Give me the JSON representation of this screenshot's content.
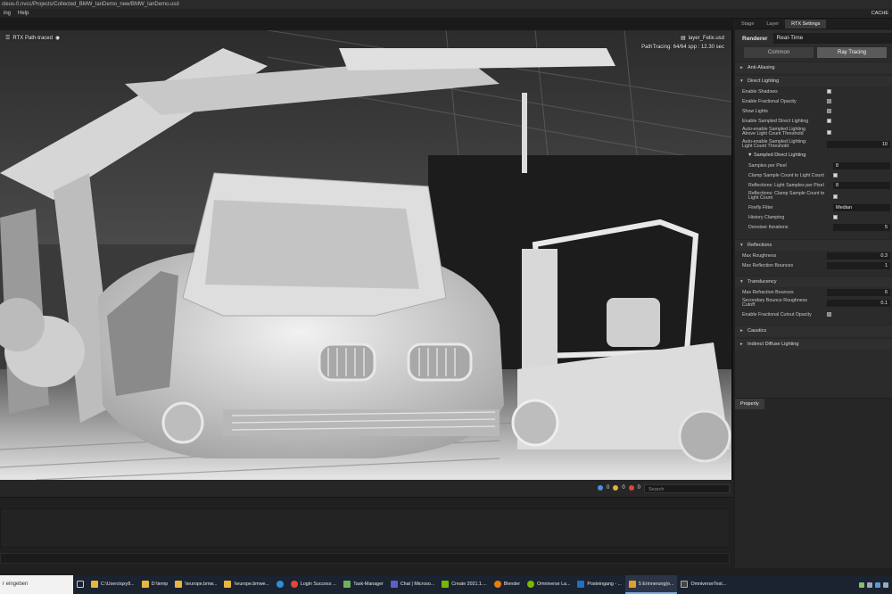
{
  "window": {
    "title_path": "cleus-0.nvcc/Projects/Collected_BMW_IanDemo_new/BMW_IanDemo.usd"
  },
  "menu": {
    "items": [
      "ing",
      "Help"
    ],
    "cache_label": "CACHE"
  },
  "viewport": {
    "render_mode": "RTX Path-traced",
    "layer_name": "layer_Felix.usd",
    "stats": "PathTracing: 64/64 spp : 12.30 sec"
  },
  "right_panel": {
    "tabs": [
      "Stage",
      "Layer",
      "RTX Settings"
    ],
    "active_tab": "RTX Settings",
    "renderer_label": "Renderer",
    "renderer_value": "Real-Time",
    "mode_buttons": [
      "Common",
      "Ray Tracing"
    ],
    "active_mode": "Ray Tracing",
    "sections": {
      "anti_aliasing": "Anti-Aliasing",
      "direct_lighting": "Direct Lighting",
      "reflections": "Reflections",
      "translucency": "Translucency",
      "caustics": "Caustics",
      "indirect_diffuse": "Indirect Diffuse Lighting"
    },
    "direct_lighting": {
      "enable_shadows": "Enable Shadows",
      "enable_fractional_opacity": "Enable Fractional Opacity",
      "show_lights": "Show Lights",
      "enable_sampled_direct": "Enable Sampled Direct Lighting",
      "auto_enable_above_line1": "Auto-enable Sampled Lighting",
      "auto_enable_above_line2": "Above Light Count Threshold",
      "auto_threshold_line1": "Auto-enable Sampled Lighting:",
      "auto_threshold_line2": "Light Count Threshold",
      "auto_threshold_value": "10",
      "sampled_subheader": "Sampled Direct Lighting",
      "samples_per_pixel": "Samples per Pixel",
      "samples_per_pixel_value": "8",
      "clamp_sample_count": "Clamp Sample Count to Light Count",
      "reflections_light_samples": "Reflections: Light Samples per Pixel",
      "reflections_light_samples_value": "8",
      "reflections_clamp_line1": "Reflections: Clamp Sample Count to",
      "reflections_clamp_line2": "Light Count",
      "firefly_filter": "Firefly Filter",
      "firefly_filter_value": "Median",
      "history_clamping": "History Clamping",
      "denoiser_iterations": "Denoiser Iterations",
      "denoiser_iterations_value": "5"
    },
    "reflections": {
      "max_roughness": "Max Roughness",
      "max_roughness_value": "0.3",
      "max_bounces": "Max Reflection Bounces",
      "max_bounces_value": "1"
    },
    "translucency": {
      "max_refraction": "Max Refraction Bounces",
      "max_refraction_value": "6",
      "secondary_line1": "Secondary Bounce Roughness",
      "secondary_line2": "Cutoff",
      "secondary_value": "0.1",
      "fractional_cutout": "Enable Fractional Cutout Opacity"
    }
  },
  "property_panel": {
    "tab": "Property"
  },
  "console": {
    "info_count": "0",
    "warn_count": "0",
    "error_count": "0",
    "search_placeholder": "Search"
  },
  "taskbar": {
    "search_text": "r eingeben",
    "items": [
      "C:\\Users\\qxy8...",
      "D:\\temp",
      "\\\\europe.bmw...",
      "\\\\europe.bmwe...",
      "Login Success ...",
      "Task-Manager",
      "Chat | Microso...",
      "Create 2021.1....",
      "Blender",
      "Omniverse La...",
      "Posteingang - ...",
      "5 Erinnerung(e...",
      "OmniverseTest..."
    ]
  },
  "colors": {
    "accent": "#7fa6e0",
    "panel": "#2b2b2b",
    "viewport_bg": "#3a3a3a"
  }
}
